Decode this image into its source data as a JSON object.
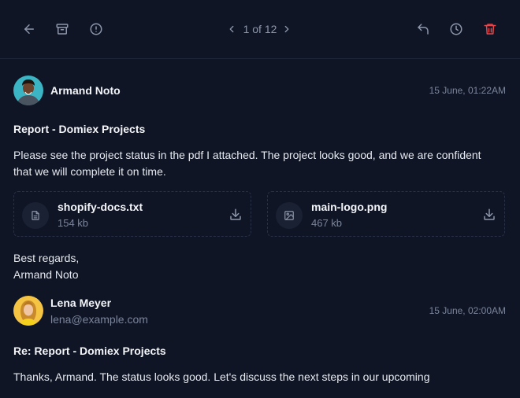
{
  "toolbar": {
    "pager_text": "1 of 12",
    "icons": {
      "back": "arrow-left-icon",
      "archive": "archive-icon",
      "spam": "alert-circle-icon",
      "prev": "chevron-left-icon",
      "next": "chevron-right-icon",
      "reply": "reply-icon",
      "snooze": "clock-icon",
      "delete": "trash-icon"
    },
    "colors": {
      "icon": "#8d97ab",
      "delete": "#e5484d"
    }
  },
  "messages": [
    {
      "sender": "Armand Noto",
      "time": "15 June, 01:22AM",
      "subject": "Report - Domiex Projects",
      "body": "Please see the project status in the pdf I attached. The project looks good, and we are confident that we will complete it on time.",
      "attachments": [
        {
          "name": "shopify-docs.txt",
          "size": "154 kb",
          "icon": "file-text-icon"
        },
        {
          "name": "main-logo.png",
          "size": "467 kb",
          "icon": "image-icon"
        }
      ],
      "signoff_line1": "Best regards,",
      "signoff_line2": "Armand Noto"
    },
    {
      "sender": "Lena Meyer",
      "email": "lena@example.com",
      "time": "15 June, 02:00AM",
      "subject": "Re: Report - Domiex Projects",
      "body": "Thanks, Armand. The status looks good. Let's discuss the next steps in our upcoming"
    }
  ]
}
